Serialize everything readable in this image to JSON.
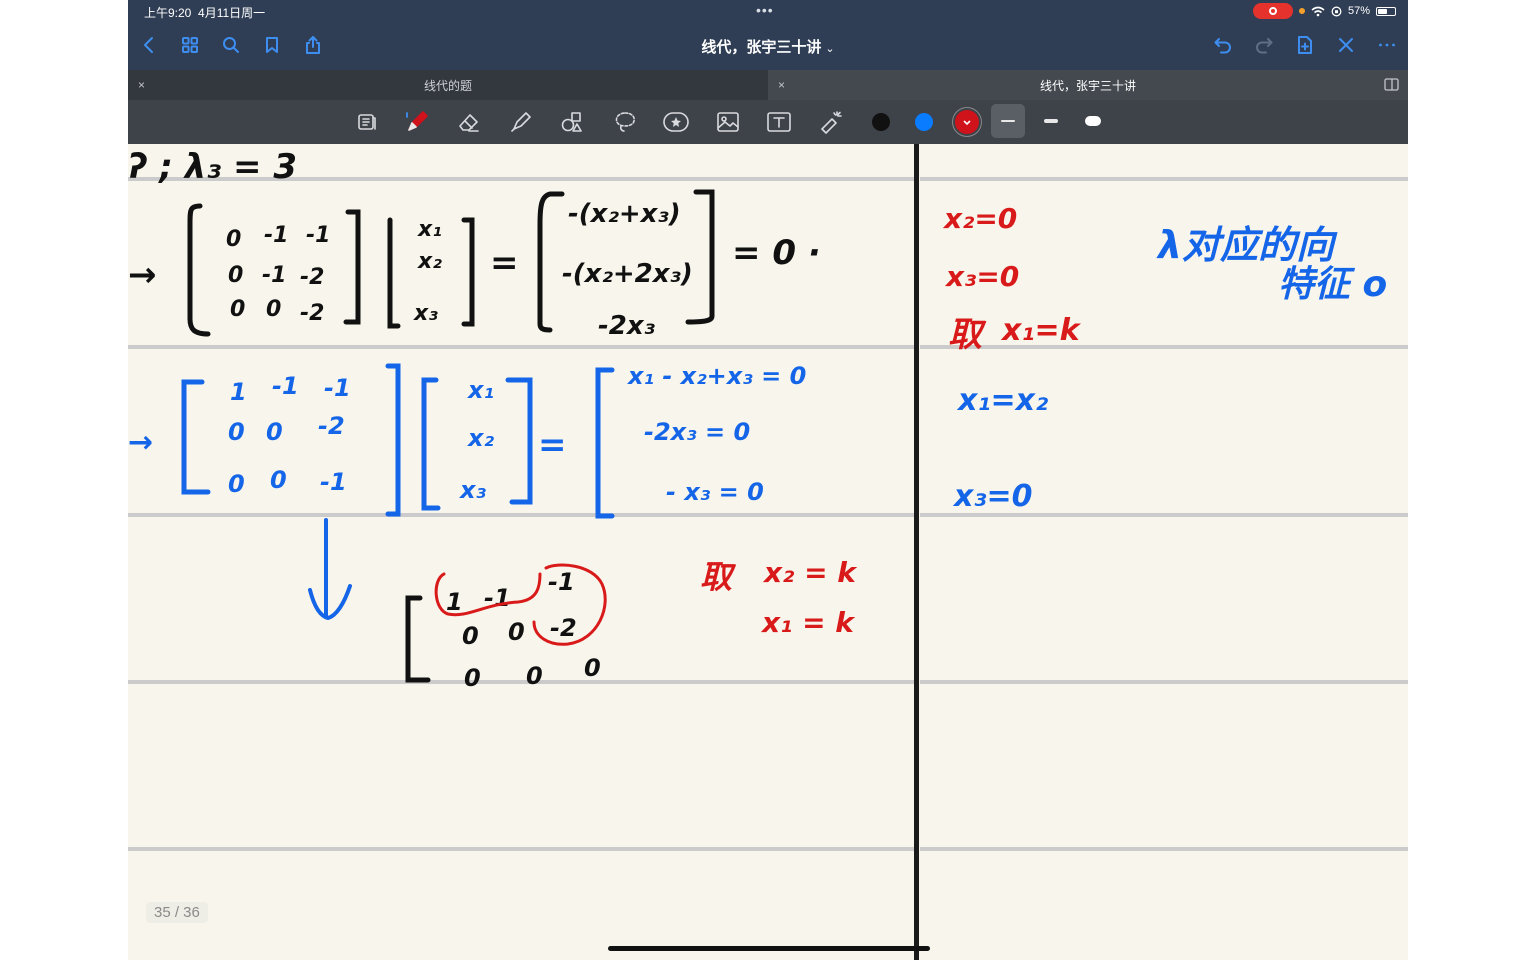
{
  "status": {
    "time": "上午9:20",
    "date": "4月11日周一",
    "battery": "57%",
    "battery_level": 0.57,
    "dots": "•••"
  },
  "nav": {
    "title": "线代，张宇三十讲",
    "title_chevron": "⌄"
  },
  "tabs": [
    {
      "label": "线代的题",
      "close": "×"
    },
    {
      "label": "线代，张宇三十讲",
      "close": "×"
    }
  ],
  "colors": {
    "black": "#111111",
    "blue": "#0a7cff",
    "red": "#d0121b",
    "ink_blue": "#1565e8",
    "ink_red": "#d91a1a"
  },
  "page": {
    "counter": "35 / 36"
  },
  "notes_left": {
    "row1": "ʔ ; λ₃ = 3",
    "row2_arrow": "→",
    "matrix_a": [
      [
        "0",
        "-1",
        "-1"
      ],
      [
        "0",
        "-1",
        "-2"
      ],
      [
        "0",
        "0",
        "-2"
      ]
    ],
    "vector_x": [
      "x₁",
      "x₂",
      "x₃"
    ],
    "eq": "=",
    "result_a": [
      "-(x₂+x₃)",
      "-(x₂+2x₃)",
      "-2x₃"
    ],
    "tail": "= 0 ·",
    "row3_arrow": "→",
    "matrix_b": [
      [
        "1",
        "-1",
        "-1"
      ],
      [
        "0",
        "0",
        "-2"
      ],
      [
        "0",
        "0",
        "-1"
      ]
    ],
    "result_b": [
      "x₁ - x₂+x₃ = 0",
      "-2x₃ = 0",
      "- x₃ = 0"
    ],
    "down_arrow": "↓",
    "matrix_c": [
      [
        "1",
        "-1",
        "-1"
      ],
      [
        "0",
        "0",
        "-2"
      ],
      [
        "0",
        "0",
        "0"
      ]
    ],
    "take_label": "取",
    "take_x2": "x₂ = k",
    "take_x1": "x₁ = k"
  },
  "notes_right": {
    "l1": "x₂=0",
    "l2": "x₃=0",
    "l3_take": "取",
    "l3": "x₁=k",
    "l4": "x₁=x₂",
    "l5": "x₃=0",
    "lambda_note_1": "λ对应的向",
    "lambda_note_2": "特征 o"
  }
}
